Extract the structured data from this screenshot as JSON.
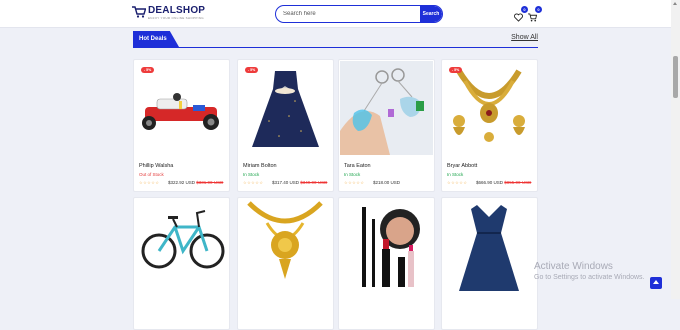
{
  "header": {
    "logo_title": "DEALSHOP",
    "logo_tagline": "ENJOY YOUR ONLINE SHOPPING",
    "search_placeholder": "Search here",
    "search_button": "Search",
    "wishlist_count": "0",
    "cart_count": "0"
  },
  "section": {
    "title": "Hot Deals",
    "show_all": "Show All"
  },
  "products": [
    {
      "name": "Phillip Walsha",
      "stock": "Out of Stock",
      "stock_color": "#e33b3b",
      "price": "$322.92 USD",
      "old_price": "$331.00 USD",
      "discount": "- 5%",
      "icon": "go-kart-image"
    },
    {
      "name": "Miriam Bolton",
      "stock": "In Stock",
      "stock_color": "#1aa34a",
      "price": "$317.40 USD",
      "old_price": "$349.00 USD",
      "discount": "- 5%",
      "icon": "girls-dress-image"
    },
    {
      "name": "Tara Eaton",
      "stock": "In Stock",
      "stock_color": "#1aa34a",
      "price": "$218.00 USD",
      "old_price": "",
      "discount": "",
      "icon": "keychain-image"
    },
    {
      "name": "Bryar Abbott",
      "stock": "In Stock",
      "stock_color": "#1aa34a",
      "price": "$666.90 USD",
      "old_price": "$855.00 USD",
      "discount": "- 5%",
      "icon": "gold-necklace-set-image"
    },
    {
      "name": "",
      "stock": "",
      "stock_color": "#1aa34a",
      "price": "",
      "old_price": "",
      "discount": "",
      "icon": "bicycle-image"
    },
    {
      "name": "",
      "stock": "",
      "stock_color": "#1aa34a",
      "price": "",
      "old_price": "",
      "discount": "",
      "icon": "gold-pendant-image"
    },
    {
      "name": "",
      "stock": "",
      "stock_color": "#1aa34a",
      "price": "",
      "old_price": "",
      "discount": "",
      "icon": "cosmetics-image"
    },
    {
      "name": "",
      "stock": "",
      "stock_color": "#1aa34a",
      "price": "",
      "old_price": "",
      "discount": "",
      "icon": "navy-dress-image"
    }
  ],
  "rating_stars": "☆☆☆☆☆",
  "watermark": {
    "title": "Activate Windows",
    "subtitle": "Go to Settings to activate Windows."
  },
  "colors": {
    "accent": "#1e2fd8",
    "discount": "#ee3b3b"
  }
}
